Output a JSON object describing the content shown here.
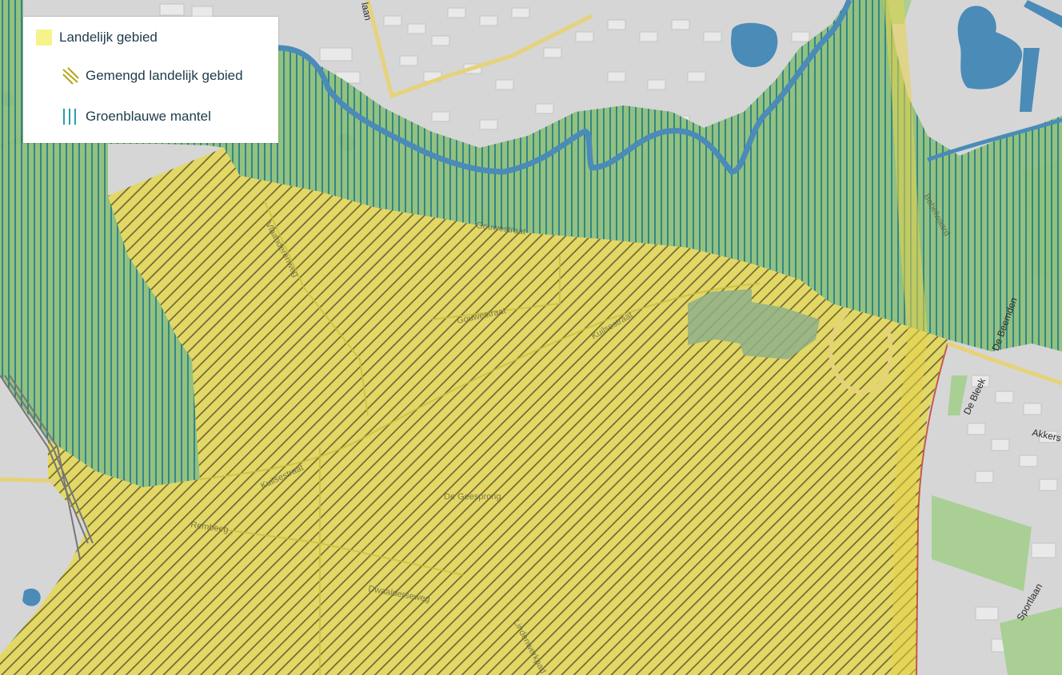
{
  "legend": {
    "items": [
      {
        "label": "Landelijk gebied",
        "swatch_color": "#f7f28a"
      },
      {
        "label": "Gemengd landelijk gebied",
        "swatch_color": "#b4a416"
      },
      {
        "label": "Groenblauwe mantel",
        "swatch_color": "#2a9bb0"
      }
    ]
  },
  "map": {
    "colors": {
      "background": "#d6d6d6",
      "water": "#4a8bb8",
      "green_zone": "#8fc07a",
      "groenblauwe_hatch": "#1f7a86",
      "landelijk_fill": "#e8dc55",
      "gemengd_hatch": "#5a5520",
      "road": "#e6d27a",
      "rail": "#777777",
      "highway_edge": "#c0392b"
    },
    "street_labels": {
      "top_lane": "laan",
      "v1": "Vlaanderenweg",
      "v2": "Gouwestraat",
      "k1": "Kuilsestraat",
      "k2": "Kuilsestraat",
      "bw": "Bakkerskreek",
      "rw": "Rembeeg",
      "dg": "De Geesprong",
      "df": "Dwaalderseweg",
      "lw": "Lindenwerkpad",
      "bv": "Bebelwaard",
      "bl": "De Beemden",
      "db": "De Bleek",
      "ak": "Akkers",
      "sp": "Sportlaan"
    }
  }
}
